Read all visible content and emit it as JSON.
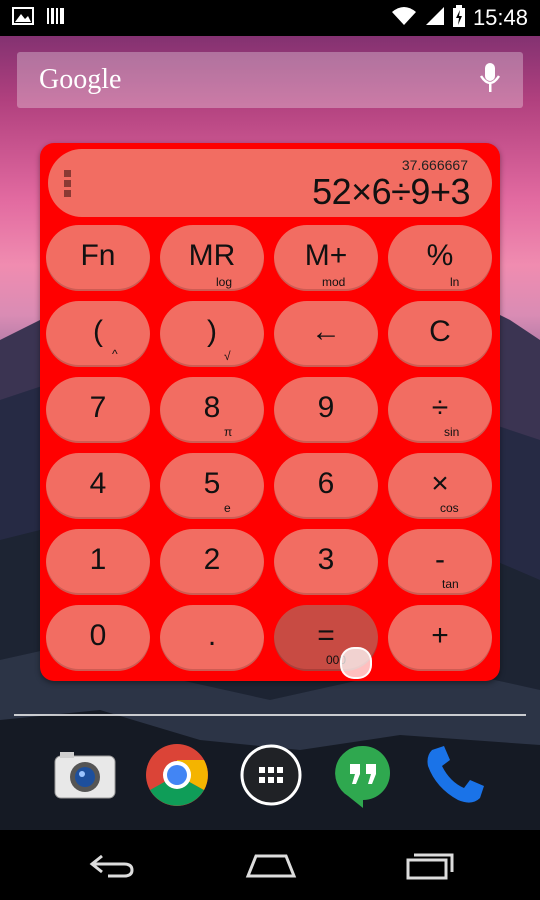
{
  "status_bar": {
    "time": "15:48"
  },
  "search": {
    "logo": "Google"
  },
  "calculator": {
    "display": {
      "result": "37.666667",
      "expression": "52×6÷9+3"
    },
    "keys": [
      {
        "label": "Fn",
        "sub": ""
      },
      {
        "label": "MR",
        "sub": "log"
      },
      {
        "label": "M+",
        "sub": "mod"
      },
      {
        "label": "%",
        "sub": "ln"
      },
      {
        "label": "(",
        "sub": "^"
      },
      {
        "label": ")",
        "sub": "√"
      },
      {
        "label": "←",
        "sub": ""
      },
      {
        "label": "C",
        "sub": ""
      },
      {
        "label": "7",
        "sub": ""
      },
      {
        "label": "8",
        "sub": "π"
      },
      {
        "label": "9",
        "sub": ""
      },
      {
        "label": "÷",
        "sub": "sin"
      },
      {
        "label": "4",
        "sub": ""
      },
      {
        "label": "5",
        "sub": "e"
      },
      {
        "label": "6",
        "sub": ""
      },
      {
        "label": "×",
        "sub": "cos"
      },
      {
        "label": "1",
        "sub": ""
      },
      {
        "label": "2",
        "sub": ""
      },
      {
        "label": "3",
        "sub": ""
      },
      {
        "label": "-",
        "sub": "tan"
      },
      {
        "label": "0",
        "sub": ""
      },
      {
        "label": ".",
        "sub": ""
      },
      {
        "label": "=",
        "sub": "000"
      },
      {
        "label": "+",
        "sub": ""
      }
    ],
    "colors": {
      "widget_bg": "#ff0000",
      "key_bg": "#f26d62",
      "pressed_key_bg": "#c84b43"
    }
  },
  "dock": {
    "icons": [
      "camera-icon",
      "chrome-icon",
      "app-drawer-icon",
      "hangouts-icon",
      "phone-icon"
    ]
  },
  "nav": {
    "icons": [
      "back-icon",
      "home-icon",
      "recents-icon"
    ]
  }
}
